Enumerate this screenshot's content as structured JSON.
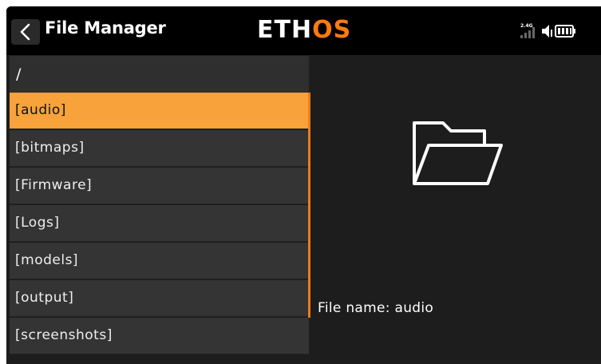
{
  "header": {
    "title": "File Manager",
    "logo_main": "ETH",
    "logo_accent": "OS",
    "radio_band": "2.4G"
  },
  "browser": {
    "current_path": "/",
    "items": [
      {
        "label": "[audio]"
      },
      {
        "label": "[bitmaps]"
      },
      {
        "label": "[Firmware]"
      },
      {
        "label": "[Logs]"
      },
      {
        "label": "[models]"
      },
      {
        "label": "[output]"
      },
      {
        "label": "[screenshots]"
      }
    ],
    "selected_index": 0
  },
  "details": {
    "file_name_text": "File name: audio",
    "icon": "folder-icon"
  },
  "colors": {
    "accent": "#ff7a0f",
    "selected_row": "#f7a23a",
    "row_bg": "#343434",
    "screen_bg": "#1d1d1d"
  }
}
